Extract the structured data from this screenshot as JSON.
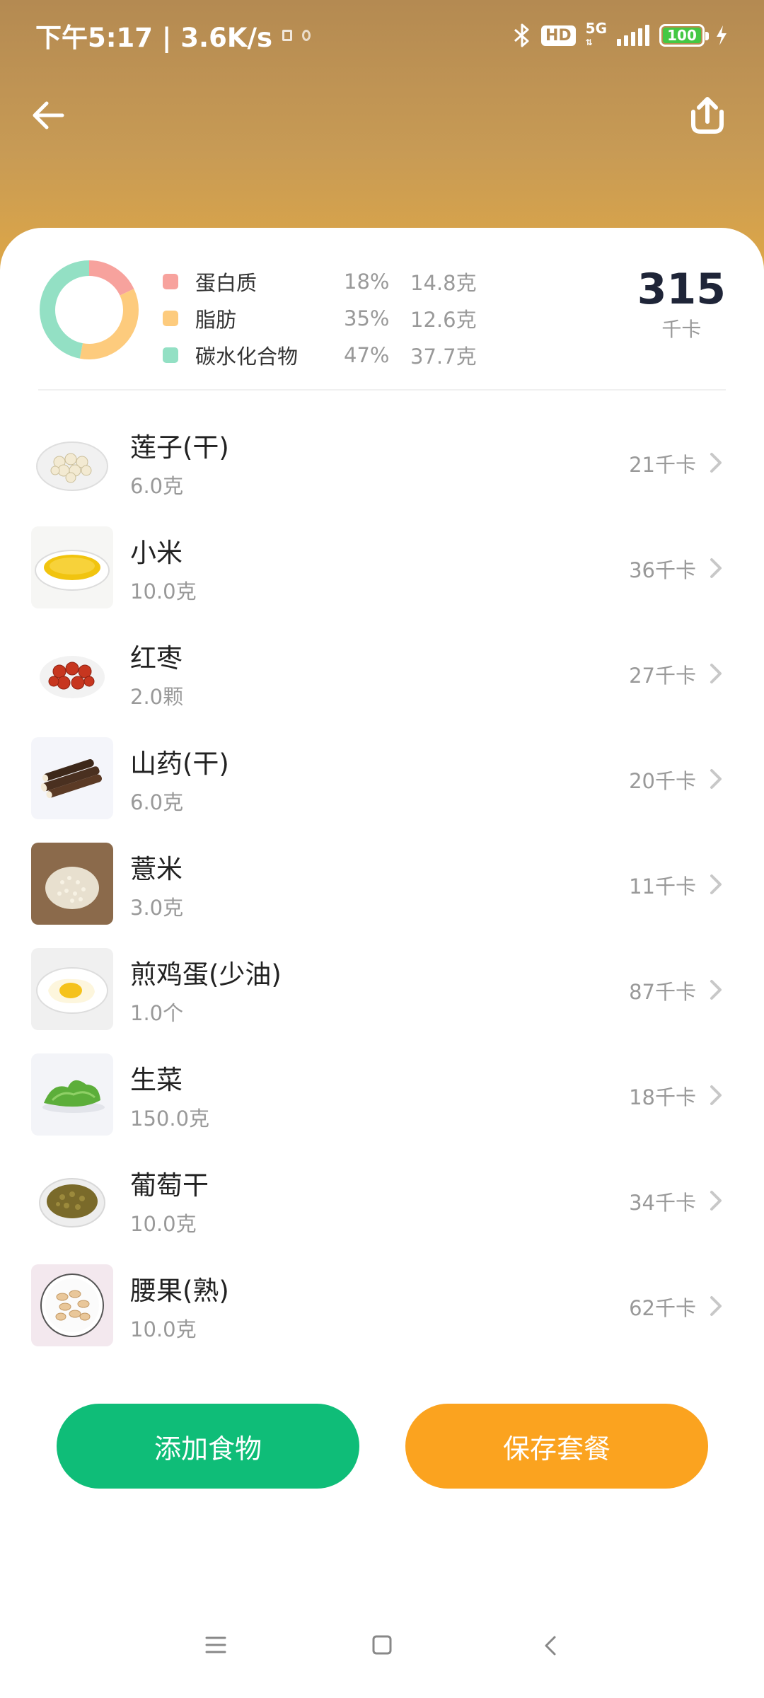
{
  "status_bar": {
    "time_speed": "下午5:17 | 3.6K/s",
    "network": "5G",
    "hd": "HD",
    "battery": "100"
  },
  "nutrition": {
    "macros": [
      {
        "name": "蛋白质",
        "percent": "18%",
        "grams": "14.8克",
        "color": "#f7a29d",
        "fraction": 0.18
      },
      {
        "name": "脂肪",
        "percent": "35%",
        "grams": "12.6克",
        "color": "#fdcb7d",
        "fraction": 0.35
      },
      {
        "name": "碳水化合物",
        "percent": "47%",
        "grams": "37.7克",
        "color": "#93e0c4",
        "fraction": 0.47
      }
    ],
    "total_kcal": "315",
    "kcal_unit": "千卡"
  },
  "foods": [
    {
      "name": "莲子(干)",
      "amount": "6.0克",
      "kcal": "21千卡",
      "icon": "lotus-seed-icon"
    },
    {
      "name": "小米",
      "amount": "10.0克",
      "kcal": "36千卡",
      "icon": "millet-icon"
    },
    {
      "name": "红枣",
      "amount": "2.0颗",
      "kcal": "27千卡",
      "icon": "jujube-icon"
    },
    {
      "name": "山药(干)",
      "amount": "6.0克",
      "kcal": "20千卡",
      "icon": "yam-icon"
    },
    {
      "name": "薏米",
      "amount": "3.0克",
      "kcal": "11千卡",
      "icon": "barley-icon"
    },
    {
      "name": "煎鸡蛋(少油)",
      "amount": "1.0个",
      "kcal": "87千卡",
      "icon": "fried-egg-icon"
    },
    {
      "name": "生菜",
      "amount": "150.0克",
      "kcal": "18千卡",
      "icon": "lettuce-icon"
    },
    {
      "name": "葡萄干",
      "amount": "10.0克",
      "kcal": "34千卡",
      "icon": "raisin-icon"
    },
    {
      "name": "腰果(熟)",
      "amount": "10.0克",
      "kcal": "62千卡",
      "icon": "cashew-icon"
    }
  ],
  "actions": {
    "add_food": "添加食物",
    "save_meal": "保存套餐"
  }
}
